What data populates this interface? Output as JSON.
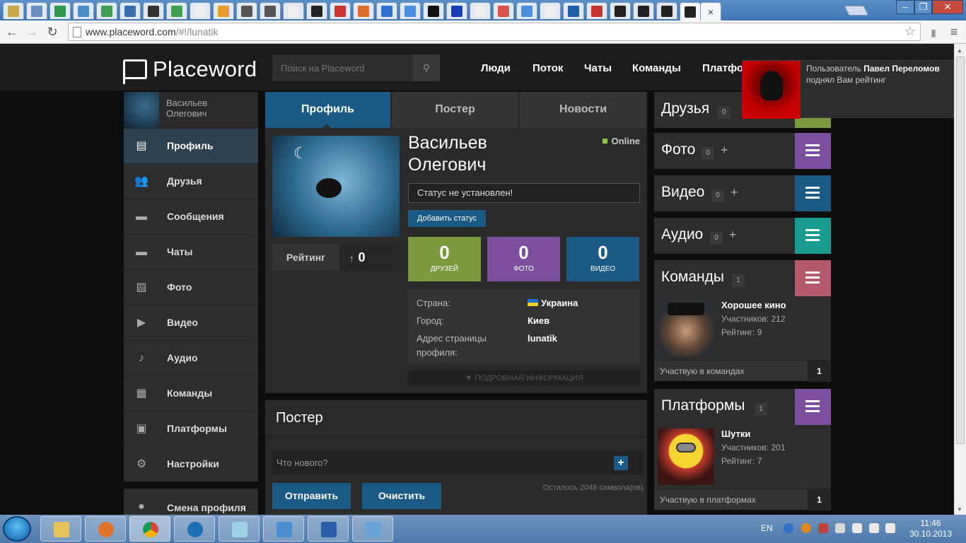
{
  "browser": {
    "url_host": "www.placeword.com",
    "url_path": "/#!/lunatik",
    "tabs_count": 30,
    "close_tab": "×"
  },
  "site": {
    "logo": "Placeword",
    "search_placeholder": "Поиск на Placeword",
    "nav": [
      "Люди",
      "Поток",
      "Чаты",
      "Команды",
      "Платформ"
    ]
  },
  "sidebar": {
    "user_name": "Васильев Олегович",
    "items": [
      {
        "label": "Профиль",
        "icon": "profile-card-icon",
        "active": true
      },
      {
        "label": "Друзья",
        "icon": "friends-icon"
      },
      {
        "label": "Сообщения",
        "icon": "messages-icon"
      },
      {
        "label": "Чаты",
        "icon": "chats-icon"
      },
      {
        "label": "Фото",
        "icon": "photo-icon"
      },
      {
        "label": "Видео",
        "icon": "video-icon"
      },
      {
        "label": "Аудио",
        "icon": "audio-icon"
      },
      {
        "label": "Команды",
        "icon": "teams-icon"
      },
      {
        "label": "Платформы",
        "icon": "platforms-icon"
      },
      {
        "label": "Настройки",
        "icon": "settings-gear-icon"
      }
    ],
    "switch_profile": "Смена профиля"
  },
  "profile": {
    "tabs": [
      "Профиль",
      "Постер",
      "Новости"
    ],
    "name": "Васильев Олегович",
    "online": "Online",
    "status": "Статус не установлен!",
    "add_status": "Добавить статус",
    "rating_label": "Рейтинг",
    "rating_value": "0",
    "stats": [
      {
        "value": "0",
        "label": "ДРУЗЕЙ",
        "color": "#7a9a3d"
      },
      {
        "value": "0",
        "label": "ФОТО",
        "color": "#7c4f9e"
      },
      {
        "value": "0",
        "label": "ВИДЕО",
        "color": "#1b5a85"
      }
    ],
    "info": {
      "country_label": "Страна:",
      "country": "Украина",
      "city_label": "Город:",
      "city": "Киев",
      "address_label": "Адрес страницы профиля:",
      "address": "lunatik"
    },
    "details": "ПОДРОБНАЯ ИНФОРМАЦИЯ"
  },
  "poster": {
    "title": "Постер",
    "placeholder": "Что нового?",
    "send": "Отправить",
    "clear": "Очистить",
    "remaining": "Осталось 2048 символа(ов)"
  },
  "right": {
    "friends": {
      "title": "Друзья",
      "count": "0"
    },
    "photo": {
      "title": "Фото",
      "count": "0",
      "color": "#7c4f9e"
    },
    "video": {
      "title": "Видео",
      "count": "0",
      "color": "#1b5a85"
    },
    "audio": {
      "title": "Аудио",
      "count": "0",
      "color": "#1a9a8f"
    },
    "teams": {
      "title": "Команды",
      "count": "1",
      "color": "#b35a6e",
      "item_name": "Хорошее кино",
      "members": "Участников: 212",
      "rating": "Рейтинг: 9",
      "footer": "Участвую в командах",
      "footer_count": "1"
    },
    "platforms": {
      "title": "Платформы",
      "count": "1",
      "color": "#7c4f9e",
      "item_name": "Шутки",
      "members": "Участников: 201",
      "rating": "Рейтинг: 7",
      "footer": "Участвую в платформах",
      "footer_count": "1"
    }
  },
  "notification": {
    "prefix": "Пользователь",
    "user": "Павел Переломов",
    "text": "поднял Вам рейтинг"
  },
  "taskbar": {
    "lang": "EN",
    "time": "11:46",
    "date": "30.10.2013"
  }
}
